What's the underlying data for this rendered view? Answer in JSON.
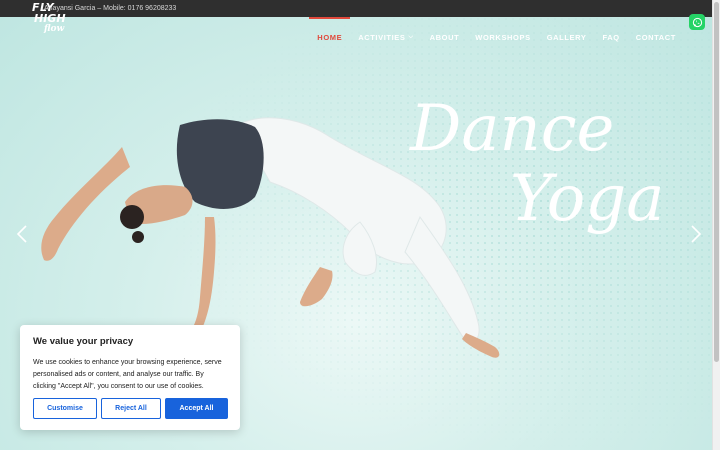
{
  "topbar": {
    "contact": "Anayansi Garcia – Mobile: 0176 96208233"
  },
  "logo": {
    "line1": "FLY",
    "line2": "HIGH",
    "line3": "flow"
  },
  "nav": {
    "items": [
      {
        "label": "HOME",
        "active": true
      },
      {
        "label": "ACTIVITIES",
        "has_dropdown": true
      },
      {
        "label": "ABOUT"
      },
      {
        "label": "WORKSHOPS"
      },
      {
        "label": "GALLERY"
      },
      {
        "label": "FAQ"
      },
      {
        "label": "CONTACT"
      }
    ]
  },
  "hero": {
    "title_line1": "Dance",
    "title_line2": "Yoga"
  },
  "slider": {
    "prev_icon": "chevron-left-icon",
    "next_icon": "chevron-right-icon"
  },
  "whatsapp": {
    "icon": "whatsapp-icon",
    "color": "#25d366"
  },
  "cookie_banner": {
    "title": "We value your privacy",
    "body": "We use cookies to enhance your browsing experience, serve personalised ads or content, and analyse our traffic. By clicking \"Accept All\", you consent to our use of cookies.",
    "customise_label": "Customise",
    "reject_label": "Reject All",
    "accept_label": "Accept All",
    "accent_color": "#1863dc"
  },
  "colors": {
    "nav_active": "#e1493c",
    "topbar_bg": "#2f2f2f",
    "hero_bg": "#cdebe7"
  }
}
